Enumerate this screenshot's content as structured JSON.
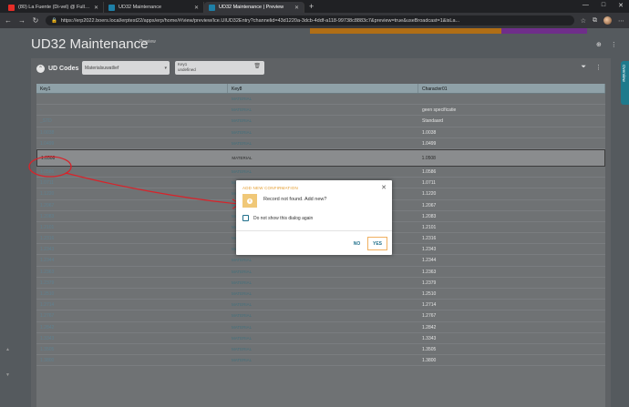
{
  "browser": {
    "tabs": [
      {
        "label": "(80) La Fuente (Di-vel) @ Full C...",
        "favicon": "youtube",
        "active": false
      },
      {
        "label": "UD32 Maintenance",
        "favicon": "app",
        "active": false
      },
      {
        "label": "UD32 Maintenance | Preview",
        "favicon": "app",
        "active": true
      }
    ],
    "new_tab": "+",
    "window_controls": [
      "—",
      "□",
      "✕"
    ],
    "url": "https://erp2022.boers.local/erptest22/apps/erp/home/#/view/preview/Ice.UIUD32Entry?channelid=43d1220a-3dcb-4ddf-a118-99738c8883c7&preview=true&useBroadcast=1&isLa...",
    "nav": {
      "back": "←",
      "forward": "→",
      "reload": "↻"
    }
  },
  "app": {
    "title": "UD32 Maintenance",
    "preview_tag": "Preview",
    "header_icons": [
      "plus-circle-icon",
      "kebab-menu-icon"
    ],
    "side_tab_label": "Overview",
    "panel": {
      "title": "UD Codes",
      "combo_value": "Materialsuwatlief",
      "key_field_label": "Key1",
      "key_field_value": "undefined"
    },
    "grid": {
      "columns": [
        "Key1",
        "Key8",
        "Character01"
      ],
      "rows": [
        {
          "key1": "",
          "key8": "MATERIAL",
          "char": ""
        },
        {
          "key1": "-",
          "key8": "MATERIAL",
          "char": "geen specificatie"
        },
        {
          "key1": "_STD",
          "key8": "MATERIAL",
          "char": "Standaard"
        },
        {
          "key1": "1.0038",
          "key8": "MATERIAL",
          "char": "1.0038"
        },
        {
          "key1": "1.0499",
          "key8": "MATERIAL",
          "char": "1.0499"
        },
        {
          "key1": "1.0508",
          "key8": "MATERIAL",
          "char": "1.0508",
          "selected": true
        },
        {
          "key1": "1.0586",
          "key8": "MATERIAL",
          "char": "1.0586"
        },
        {
          "key1": "1.0711",
          "key8": "MATERIAL",
          "char": "1.0711"
        },
        {
          "key1": "1.1220",
          "key8": "MATERIAL",
          "char": "1.1220"
        },
        {
          "key1": "1.2067",
          "key8": "MATERIAL",
          "char": "1.2067"
        },
        {
          "key1": "1.2083",
          "key8": "MATERIAL",
          "char": "1.2083"
        },
        {
          "key1": "1.2101",
          "key8": "MATERIAL",
          "char": "1.2101"
        },
        {
          "key1": "1.2316",
          "key8": "MATERIAL",
          "char": "1.2316"
        },
        {
          "key1": "1.2343",
          "key8": "MATERIAL",
          "char": "1.2343"
        },
        {
          "key1": "1.2344",
          "key8": "MATERIAL",
          "char": "1.2344"
        },
        {
          "key1": "1.2363",
          "key8": "MATERIAL",
          "char": "1.2363"
        },
        {
          "key1": "1.2379",
          "key8": "MATERIAL",
          "char": "1.2379"
        },
        {
          "key1": "1.2510",
          "key8": "MATERIAL",
          "char": "1.2510"
        },
        {
          "key1": "1.2714",
          "key8": "MATERIAL",
          "char": "1.2714"
        },
        {
          "key1": "1.2767",
          "key8": "MATERIAL",
          "char": "1.2767"
        },
        {
          "key1": "1.2842",
          "key8": "MATERIAL",
          "char": "1.2842"
        },
        {
          "key1": "1.3343",
          "key8": "MATERIAL",
          "char": "1.3343"
        },
        {
          "key1": "1.3505",
          "key8": "MATERIAL",
          "char": "1.3505"
        },
        {
          "key1": "1.3800",
          "key8": "MATERIAL",
          "char": "1.3800"
        }
      ]
    },
    "dialog": {
      "title": "ADD NEW CONFIRMATION",
      "message": "Record not found. Add new?",
      "checkbox_label": "Do not show this dialog again",
      "no_label": "NO",
      "yes_label": "YES"
    }
  },
  "colors": {
    "accent": "#1f6f8b",
    "warning": "#e39a2a",
    "annotation": "#d8232a"
  }
}
